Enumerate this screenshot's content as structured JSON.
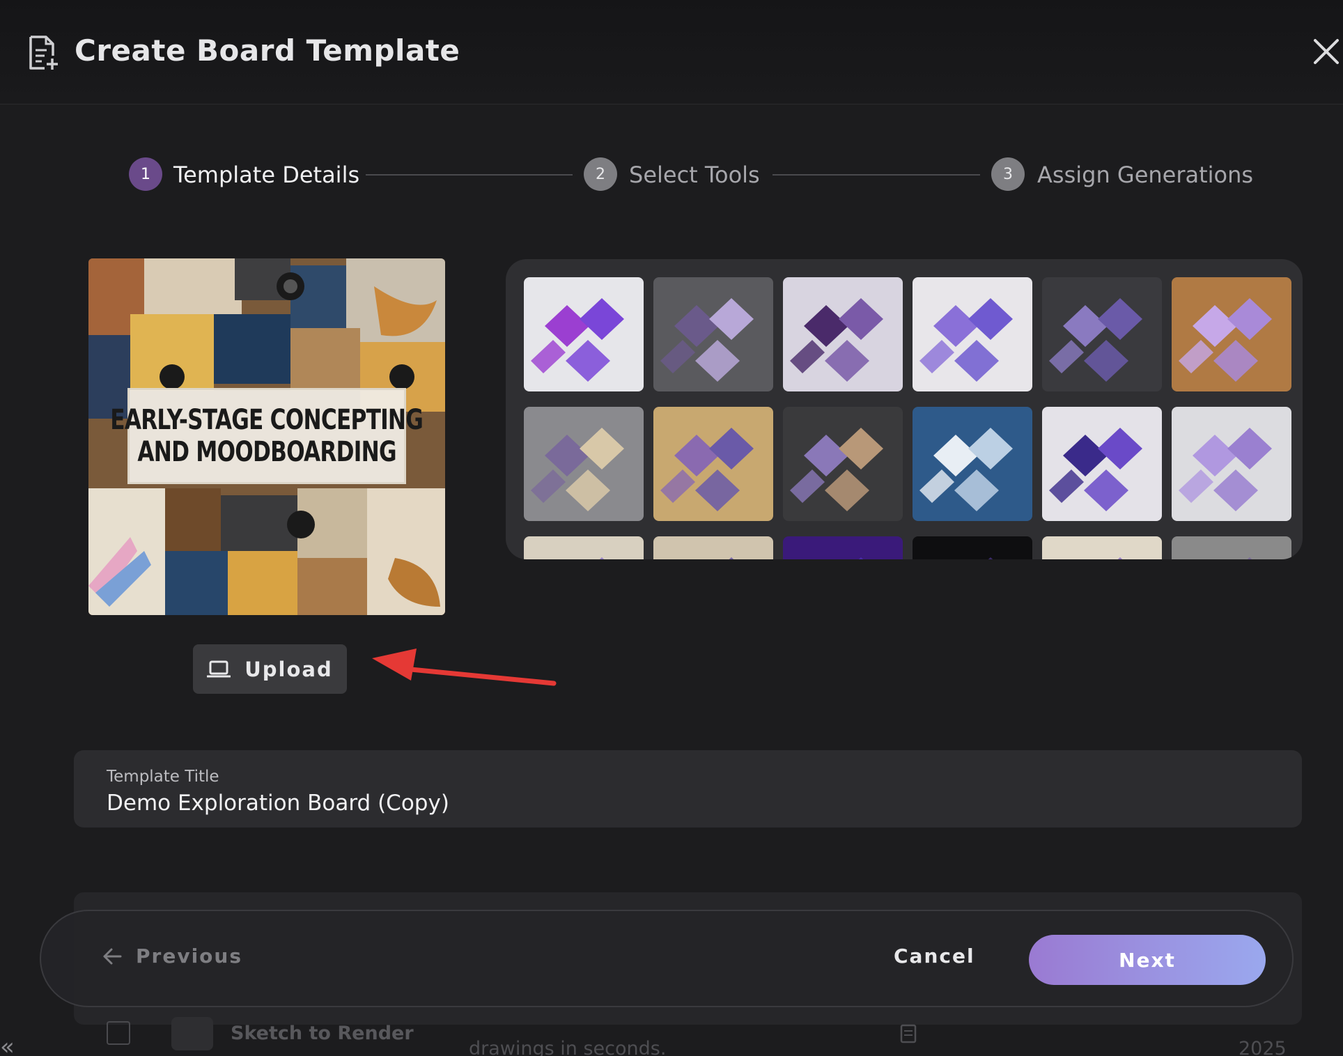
{
  "header": {
    "title": "Create Board Template"
  },
  "stepper": {
    "steps": [
      {
        "number": "1",
        "label": "Template Details",
        "state": "active"
      },
      {
        "number": "2",
        "label": "Select Tools",
        "state": "inactive"
      },
      {
        "number": "3",
        "label": "Assign Generations",
        "state": "inactive"
      }
    ]
  },
  "preview": {
    "banner_line1": "EARLY-STAGE CONCEPTING",
    "banner_line2": "AND MOODBOARDING"
  },
  "upload": {
    "label": "Upload"
  },
  "form": {
    "title_label": "Template Title",
    "title_value": "Demo Exploration Board (Copy)"
  },
  "background_list": {
    "row_name": "Sketch to Render",
    "row_description": "drawings in seconds.",
    "row_date": "2025"
  },
  "actions": {
    "previous_label": "Previous",
    "cancel_label": "Cancel",
    "next_label": "Next"
  },
  "colors": {
    "accent_step": "#6a4a8a",
    "next_gradient_start": "#9a7ad2",
    "next_gradient_end": "#9aa8ee",
    "annotation_arrow": "#e53935"
  }
}
